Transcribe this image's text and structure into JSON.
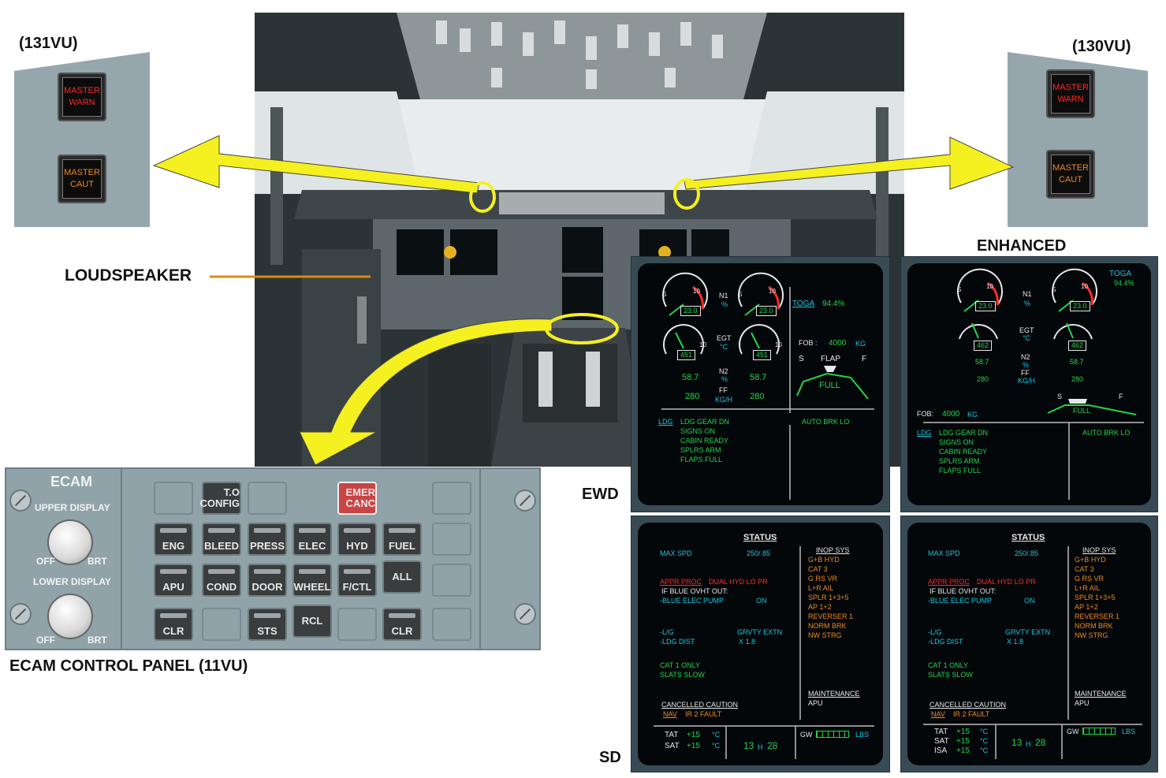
{
  "labels": {
    "vu131": "(131VU)",
    "vu130": "(130VU)",
    "loudspeaker": "LOUDSPEAKER",
    "enhanced": "ENHANCED",
    "ewd": "EWD",
    "sd": "SD",
    "ecam_panel_caption": "ECAM CONTROL PANEL (11VU)"
  },
  "warn_buttons": {
    "master_warn_l1": "MASTER",
    "master_warn_l2": "WARN",
    "master_caut_l1": "MASTER",
    "master_caut_l2": "CAUT"
  },
  "ecam_panel": {
    "title": "ECAM",
    "upper_display": "UPPER DISPLAY",
    "lower_display": "LOWER DISPLAY",
    "off": "OFF",
    "brt": "BRT",
    "keys": {
      "to_config_l1": "T.O",
      "to_config_l2": "CONFIG",
      "emer_canc_l1": "EMER",
      "emer_canc_l2": "CANC",
      "eng": "ENG",
      "bleed": "BLEED",
      "press": "PRESS",
      "elec": "ELEC",
      "hyd": "HYD",
      "fuel": "FUEL",
      "apu": "APU",
      "cond": "COND",
      "door": "DOOR",
      "wheel": "WHEEL",
      "fctl": "F/CTL",
      "all": "ALL",
      "clr": "CLR",
      "sts": "STS",
      "rcl": "RCL"
    }
  },
  "ewd": {
    "n1_value": "23.0",
    "egt_value": "451",
    "egt_value_enh": "462",
    "n1": "N1",
    "pct": "%",
    "egt": "EGT",
    "degc": "°C",
    "n2": "N2",
    "n2_value": "58.7",
    "ff": "FF",
    "kgh": "KG/H",
    "ff_value": "280",
    "toga": "TOGA",
    "toga_value": "94.4%",
    "fob": "FOB :",
    "fob_value": "4000",
    "kg": "KG",
    "fob_enh": "FOB:",
    "flap": "FLAP",
    "s": "S",
    "f": "F",
    "full": "FULL",
    "ldg": "LDG",
    "memo": [
      "LDG GEAR DN",
      "SIGNS ON",
      "CABIN READY",
      "SPLRS ARM",
      "FLAPS FULL"
    ],
    "auto_brk": "AUTO BRK LO",
    "ten": "10",
    "five": "5"
  },
  "sd": {
    "status": "STATUS",
    "max_spd": "MAX SPD",
    "max_spd_value": "250/.85",
    "appr_proc": "APPR PROC",
    "dual_hyd": "DUAL HYD LO PR",
    "if_blue": "IF BLUE OVHT OUT:",
    "blue_elec": "-BLUE ELEC PUMP",
    "on": "ON",
    "lg": "-L/G",
    "grvty": "GRVTY EXTN",
    "ldg_dist": "-LDG DIST",
    "x18": "X 1.8",
    "cat1": "CAT 1 ONLY",
    "slats": "SLATS SLOW",
    "cancelled": "CANCELLED CAUTION",
    "nav": "NAV",
    "ir2": "IR 2 FAULT",
    "inop_sys": "INOP SYS",
    "inop_list": [
      "G+B HYD",
      "CAT 3",
      "G RS VR",
      "L+R AIL",
      "SPLR 1+3+5",
      "AP 1+2",
      "REVERSER 1",
      "NORM BRK",
      "NW STRG"
    ],
    "maintenance": "MAINTENANCE",
    "apu": "APU",
    "tat": "TAT",
    "sat": "SAT",
    "isa": "ISA",
    "plus15": "+15",
    "degc": "°C",
    "time_h": "13",
    "h": "H",
    "time_m": "28",
    "gw": "GW",
    "lbs": "LBS"
  },
  "colors": {
    "arrow": "#f5f020",
    "panel_grey": "#95a7ad",
    "screen_green": "#23d44a",
    "screen_cyan": "#19c8e0",
    "screen_amber": "#f08a1c",
    "screen_red": "#ff2a2a"
  }
}
